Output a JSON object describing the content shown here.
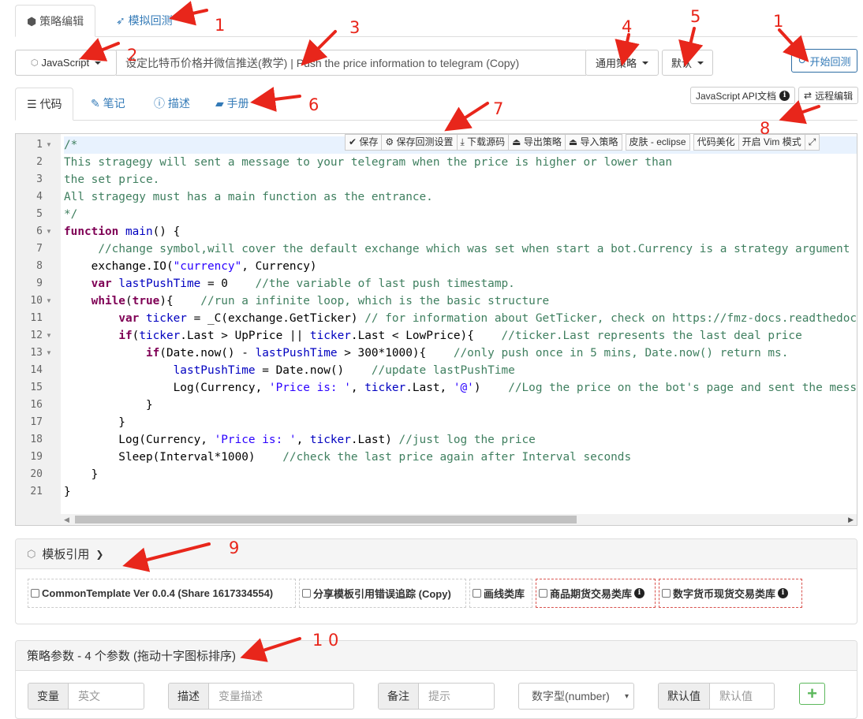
{
  "top_tabs": [
    {
      "label": "策略编辑",
      "icon": "cubes-icon"
    },
    {
      "label": "模拟回测",
      "icon": "rocket-icon"
    }
  ],
  "toolbar": {
    "language": "JavaScript",
    "strategy_name": "设定比特币价格并微信推送(教学) | Push the price information to telegram (Copy)",
    "category": "通用策略",
    "default_label": "默认",
    "run_backtest": "开始回测"
  },
  "code_tabs": [
    {
      "label": "代码",
      "icon": "list-icon"
    },
    {
      "label": "笔记",
      "icon": "edit-icon"
    },
    {
      "label": "描述",
      "icon": "info-icon"
    },
    {
      "label": "手册",
      "icon": "book-icon"
    }
  ],
  "side_buttons": {
    "api_docs": "JavaScript API文档",
    "remote_edit": "远程编辑"
  },
  "editor_toolbar": [
    "保存",
    "保存回测设置",
    "下载源码",
    "导出策略",
    "导入策略",
    "皮肤 - eclipse",
    "代码美化",
    "开启 Vim 模式"
  ],
  "code": {
    "line_numbers": [
      "1",
      "2",
      "3",
      "4",
      "5",
      "6",
      "7",
      "8",
      "9",
      "10",
      "11",
      "12",
      "13",
      "14",
      "15",
      "16",
      "17",
      "18",
      "19",
      "20",
      "21"
    ],
    "fold_lines": [
      "1",
      "6",
      "10",
      "12",
      "13"
    ]
  },
  "templates": {
    "title": "模板引用",
    "items": [
      "CommonTemplate Ver 0.0.4 (Share 1617334554)",
      "分享模板引用错误追踪 (Copy)",
      "画线类库",
      "商品期货交易类库",
      "数字货币现货交易类库"
    ]
  },
  "params": {
    "title": "策略参数 - 4 个参数 (拖动十字图标排序)",
    "var_label": "变量",
    "var_placeholder": "英文",
    "desc_label": "描述",
    "desc_placeholder": "变量描述",
    "note_label": "备注",
    "note_placeholder": "提示",
    "type_value": "数字型(number)",
    "default_label": "默认值",
    "default_placeholder": "默认值"
  },
  "annotations": [
    "1",
    "2",
    "3",
    "4",
    "5",
    "1",
    "6",
    "7",
    "8",
    "9",
    "1 0"
  ]
}
